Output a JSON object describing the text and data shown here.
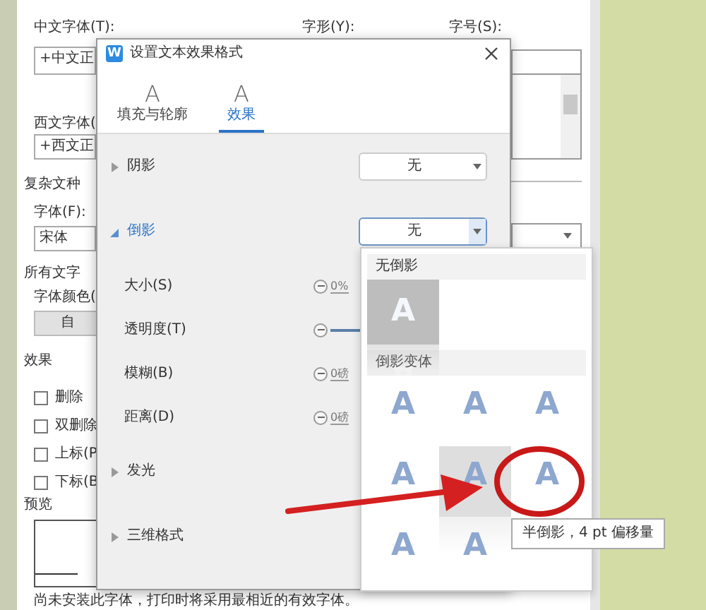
{
  "font_dialog": {
    "top_labels": [
      "中文字体(T):",
      "字形(Y):",
      "字号(S):"
    ],
    "chinese_font_field": "+中文正",
    "western_font_label": "西文字体(",
    "western_font_field": "+西文正",
    "complex_section": "复杂文种",
    "font_label": "字体(F):",
    "font_field": "宋体",
    "all_text_section": "所有文字",
    "font_color_label": "字体颜色(",
    "color_button": "自",
    "effects_section": "效果",
    "checkboxes": [
      {
        "label": "删除",
        "checked": false
      },
      {
        "label": "双删除",
        "checked": false
      },
      {
        "label": "上标(P",
        "checked": false
      },
      {
        "label": "下标(B",
        "checked": false
      }
    ],
    "preview_section": "预览",
    "note": "尚未安装此字体，打印时将采用最相近的有效字体。"
  },
  "effects_dialog": {
    "app_icon": "W",
    "title": "设置文本效果格式",
    "tabs": [
      {
        "icon": "A",
        "label": "填充与轮廓",
        "selected": false
      },
      {
        "icon": "A",
        "label": "效果",
        "selected": true
      }
    ],
    "rows": [
      {
        "kind": "section",
        "label": "阴影",
        "expanded": false,
        "dropdown": {
          "value": "无",
          "open": false
        }
      },
      {
        "kind": "section",
        "label": "倒影",
        "expanded": true,
        "dropdown": {
          "value": "无",
          "open": true
        }
      },
      {
        "kind": "slider",
        "label": "大小(S)",
        "reading": "0%"
      },
      {
        "kind": "slider",
        "label": "透明度(T)"
      },
      {
        "kind": "slider",
        "label": "模糊(B)",
        "reading": "0磅"
      },
      {
        "kind": "slider",
        "label": "距离(D)",
        "reading": "0磅"
      },
      {
        "kind": "section",
        "label": "发光",
        "expanded": false
      },
      {
        "kind": "section",
        "label": "三维格式",
        "expanded": false
      }
    ]
  },
  "dropdown_menu": {
    "groups": [
      {
        "title": "无倒影",
        "options": [
          {
            "kind": "none",
            "text": "A",
            "selected": true
          }
        ]
      },
      {
        "title": "倒影变体",
        "options": [
          {
            "kind": "reflection",
            "text": "A",
            "selected": false
          },
          {
            "kind": "reflection",
            "text": "A",
            "selected": false
          },
          {
            "kind": "reflection",
            "text": "A",
            "selected": false
          },
          {
            "kind": "reflection",
            "text": "A",
            "selected": false
          },
          {
            "kind": "reflection",
            "text": "A",
            "selected": true
          },
          {
            "kind": "reflection",
            "text": "A",
            "selected": false
          },
          {
            "kind": "reflection",
            "text": "A",
            "selected": false
          },
          {
            "kind": "reflection",
            "text": "A",
            "selected": false
          }
        ]
      }
    ]
  },
  "tooltip": "半倒影，4 pt 偏移量"
}
